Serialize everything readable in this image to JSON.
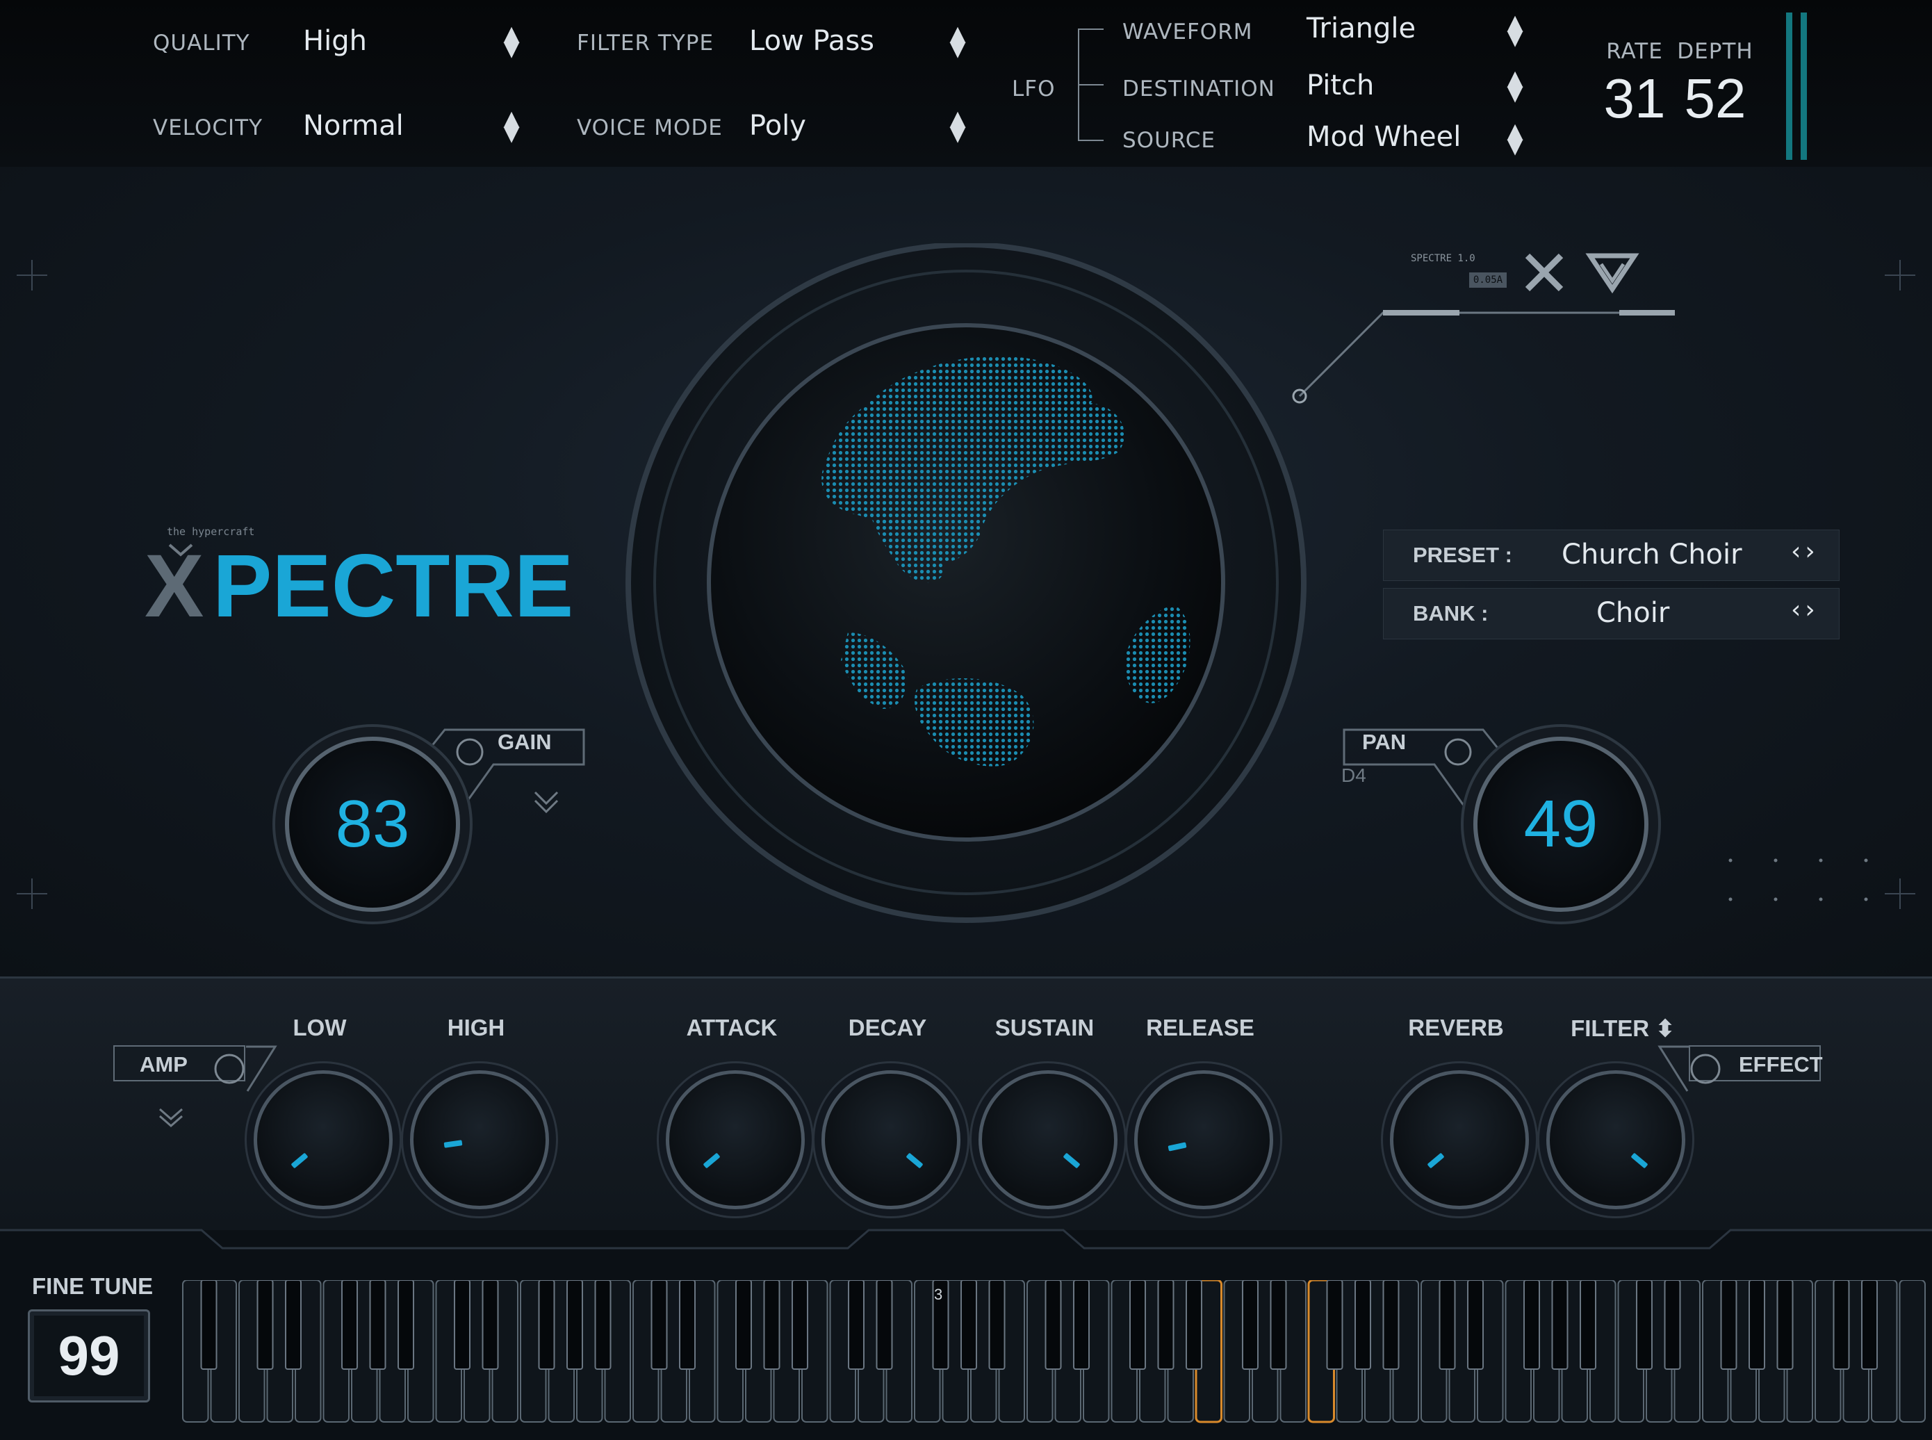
{
  "top": {
    "quality": {
      "label": "QUALITY",
      "value": "High"
    },
    "velocity": {
      "label": "VELOCITY",
      "value": "Normal"
    },
    "filter_type": {
      "label": "FILTER TYPE",
      "value": "Low Pass"
    },
    "voice_mode": {
      "label": "VOICE MODE",
      "value": "Poly"
    },
    "lfo": {
      "label": "LFO",
      "waveform": {
        "label": "WAVEFORM",
        "value": "Triangle"
      },
      "destination": {
        "label": "DESTINATION",
        "value": "Pitch"
      },
      "source": {
        "label": "SOURCE",
        "value": "Mod Wheel"
      }
    },
    "rate": {
      "label": "RATE",
      "value": "31"
    },
    "depth": {
      "label": "DEPTH",
      "value": "52"
    },
    "spinner_icon": "updown-arrows-icon"
  },
  "brand": {
    "logo_x": "X",
    "logo_rest": "PECTRE",
    "logo_small": "the hypercraft"
  },
  "badge": {
    "small_text": "SPECTRE 1.0",
    "box_text": "0.05A"
  },
  "preset": {
    "label": "PRESET :",
    "value": "Church Choir"
  },
  "bank": {
    "label": "BANK :",
    "value": "Choir"
  },
  "gain": {
    "label": "GAIN",
    "value": "83"
  },
  "pan": {
    "label": "PAN",
    "value": "49",
    "note": "D4"
  },
  "knobs": {
    "amp_tag": "AMP",
    "effect_tag": "EFFECT",
    "low": "LOW",
    "high": "HIGH",
    "attack": "ATTACK",
    "decay": "DECAY",
    "sustain": "SUSTAIN",
    "release": "RELEASE",
    "reverb": "REVERB",
    "filter": "FILTER ⬍"
  },
  "fine_tune": {
    "label": "FINE TUNE",
    "value": "99"
  },
  "keyboard": {
    "octave_marker": "3",
    "highlight_color": "#d98a2b",
    "accent": "#1fb2e2"
  }
}
